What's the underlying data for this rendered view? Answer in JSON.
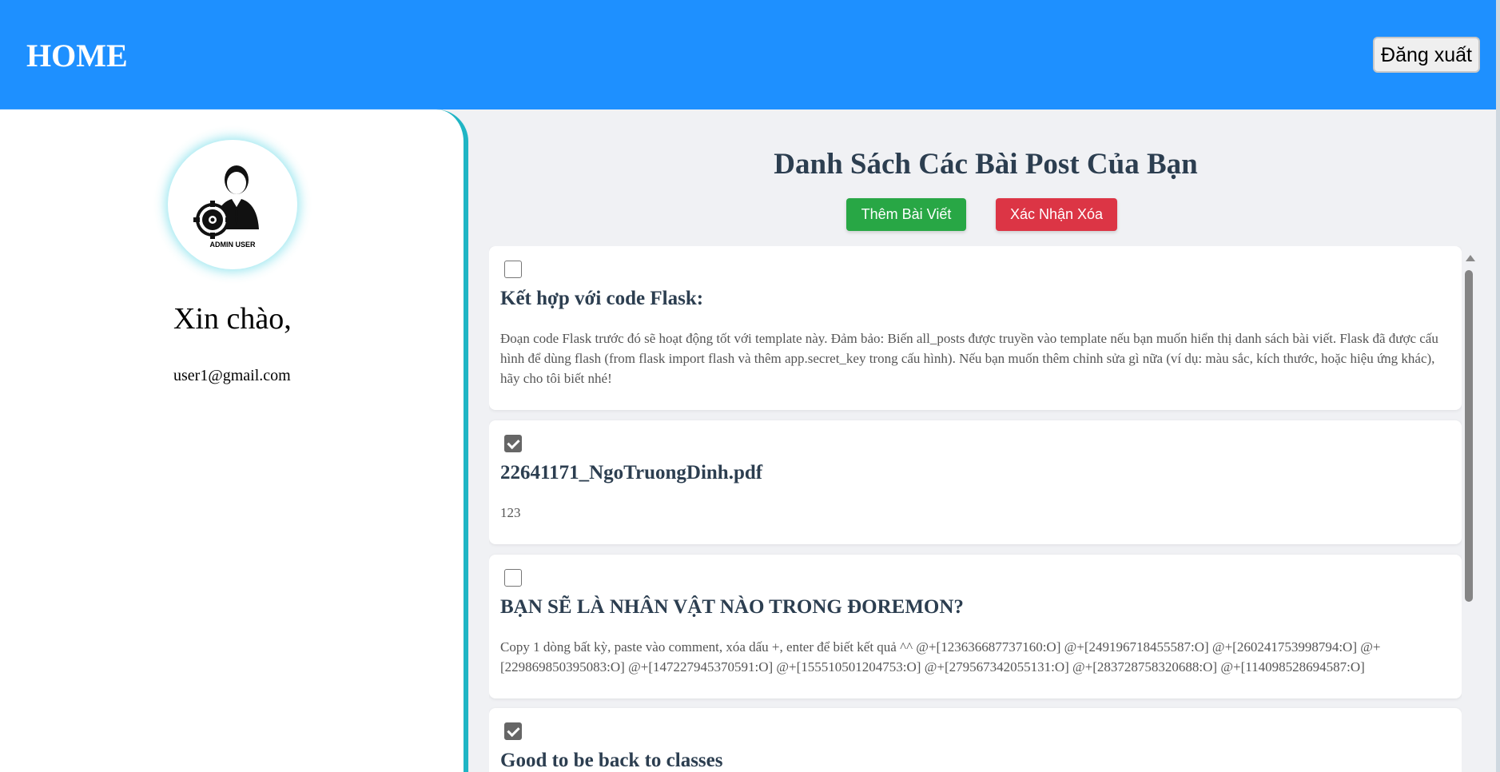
{
  "header": {
    "title": "HOME",
    "logout_label": "Đăng xuất"
  },
  "sidebar": {
    "avatar_caption": "ADMIN USER",
    "greeting": "Xin chào,",
    "email": "user1@gmail.com"
  },
  "main": {
    "title": "Danh Sách Các Bài Post Của Bạn",
    "add_label": "Thêm Bài Viết",
    "delete_label": "Xác Nhận Xóa",
    "posts": [
      {
        "checked": false,
        "title": "Kết hợp với code Flask:",
        "body": "Đoạn code Flask trước đó sẽ hoạt động tốt với template này. Đảm bảo: Biến all_posts được truyền vào template nếu bạn muốn hiển thị danh sách bài viết. Flask đã được cấu hình để dùng flash (from flask import flash và thêm app.secret_key trong cấu hình). Nếu bạn muốn thêm chỉnh sửa gì nữa (ví dụ: màu sắc, kích thước, hoặc hiệu ứng khác), hãy cho tôi biết nhé!"
      },
      {
        "checked": true,
        "title": "22641171_NgoTruongDinh.pdf",
        "body": "123"
      },
      {
        "checked": false,
        "title": "BẠN SẼ LÀ NHÂN VẬT NÀO TRONG ĐOREMON?",
        "body": "Copy 1 dòng bất kỳ, paste vào comment, xóa dấu +, enter để biết kết quả ^^ @+[123636687737160:O] @+[249196718455587:O] @+[260241753998794:O] @+[229869850395083:O] @+[147227945370591:O] @+[155510501204753:O] @+[279567342055131:O] @+[283728758320688:O] @+[114098528694587:O]"
      },
      {
        "checked": true,
        "title": "Good to be back to classes",
        "body": ""
      }
    ]
  },
  "colors": {
    "header_bg": "#1e90ff",
    "sidebar_border": "#1fb5c4",
    "add_button": "#28a745",
    "delete_button": "#dc3545",
    "title_text": "#2c3e50"
  }
}
